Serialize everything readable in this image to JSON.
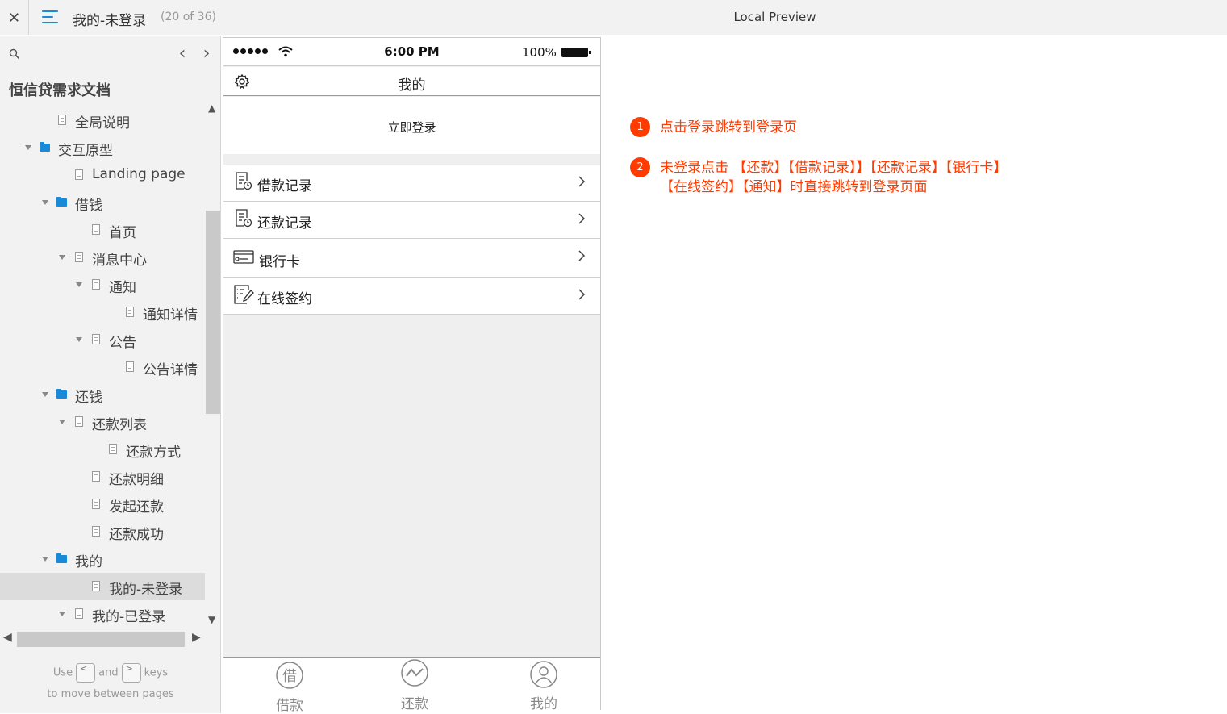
{
  "topbar": {
    "close_glyph": "✕",
    "page_title": "我的-未登录",
    "page_count": "(20 of 36)",
    "preview_title": "Local Preview"
  },
  "sidebar": {
    "prev_glyph": "‹",
    "next_glyph": "›",
    "project_title": "恒信贷需求文档",
    "tree": [
      {
        "label": "全局说明",
        "type": "page",
        "level": 2,
        "caret": false
      },
      {
        "label": "交互原型",
        "type": "folder",
        "level": 1,
        "caret": true
      },
      {
        "label": "Landing page",
        "type": "page",
        "level": 3,
        "caret": false
      },
      {
        "label": "借钱",
        "type": "folder",
        "level": 2,
        "caret": true
      },
      {
        "label": "首页",
        "type": "page",
        "level": 4,
        "caret": false
      },
      {
        "label": "消息中心",
        "type": "page",
        "level": 3,
        "caret": true
      },
      {
        "label": "通知",
        "type": "page",
        "level": 4,
        "caret": true
      },
      {
        "label": "通知详情",
        "type": "page",
        "level": 6,
        "caret": false
      },
      {
        "label": "公告",
        "type": "page",
        "level": 4,
        "caret": true
      },
      {
        "label": "公告详情",
        "type": "page",
        "level": 6,
        "caret": false
      },
      {
        "label": "还钱",
        "type": "folder",
        "level": 2,
        "caret": true
      },
      {
        "label": "还款列表",
        "type": "page",
        "level": 3,
        "caret": true
      },
      {
        "label": "还款方式",
        "type": "page",
        "level": 5,
        "caret": false
      },
      {
        "label": "还款明细",
        "type": "page",
        "level": 4,
        "caret": false
      },
      {
        "label": "发起还款",
        "type": "page",
        "level": 4,
        "caret": false
      },
      {
        "label": "还款成功",
        "type": "page",
        "level": 4,
        "caret": false
      },
      {
        "label": "我的",
        "type": "folder",
        "level": 2,
        "caret": true
      },
      {
        "label": "我的-未登录",
        "type": "page",
        "level": 4,
        "caret": false,
        "selected": true
      },
      {
        "label": "我的-已登录",
        "type": "page",
        "level": 3,
        "caret": true
      }
    ],
    "hint_use": "Use",
    "hint_and": "and",
    "hint_keys": "keys",
    "hint_line2": "to move between pages",
    "key_prev": "<",
    "key_next": ">"
  },
  "phone": {
    "time": "6:00 PM",
    "battery": "100%",
    "nav_title": "我的",
    "login_link": "立即登录",
    "menu": [
      {
        "label": "借款记录",
        "icon": "loan-record-icon"
      },
      {
        "label": "还款记录",
        "icon": "repay-record-icon"
      },
      {
        "label": "银行卡",
        "icon": "bank-card-icon"
      },
      {
        "label": "在线签约",
        "icon": "online-sign-icon"
      }
    ],
    "tabs": [
      {
        "label": "借款",
        "icon": "borrow-tab-icon"
      },
      {
        "label": "还款",
        "icon": "repay-tab-icon"
      },
      {
        "label": "我的",
        "icon": "profile-tab-icon"
      }
    ]
  },
  "notes": [
    {
      "num": "1",
      "lines": [
        "点击登录跳转到登录页"
      ]
    },
    {
      "num": "2",
      "lines": [
        "未登录点击 【还款】【借款记录】】【还款记录】【银行卡】",
        "【在线签约】【通知】时直接跳转到登录页面"
      ]
    }
  ],
  "colors": {
    "accent": "#1a8ad6",
    "note_red": "#ff3b00"
  }
}
